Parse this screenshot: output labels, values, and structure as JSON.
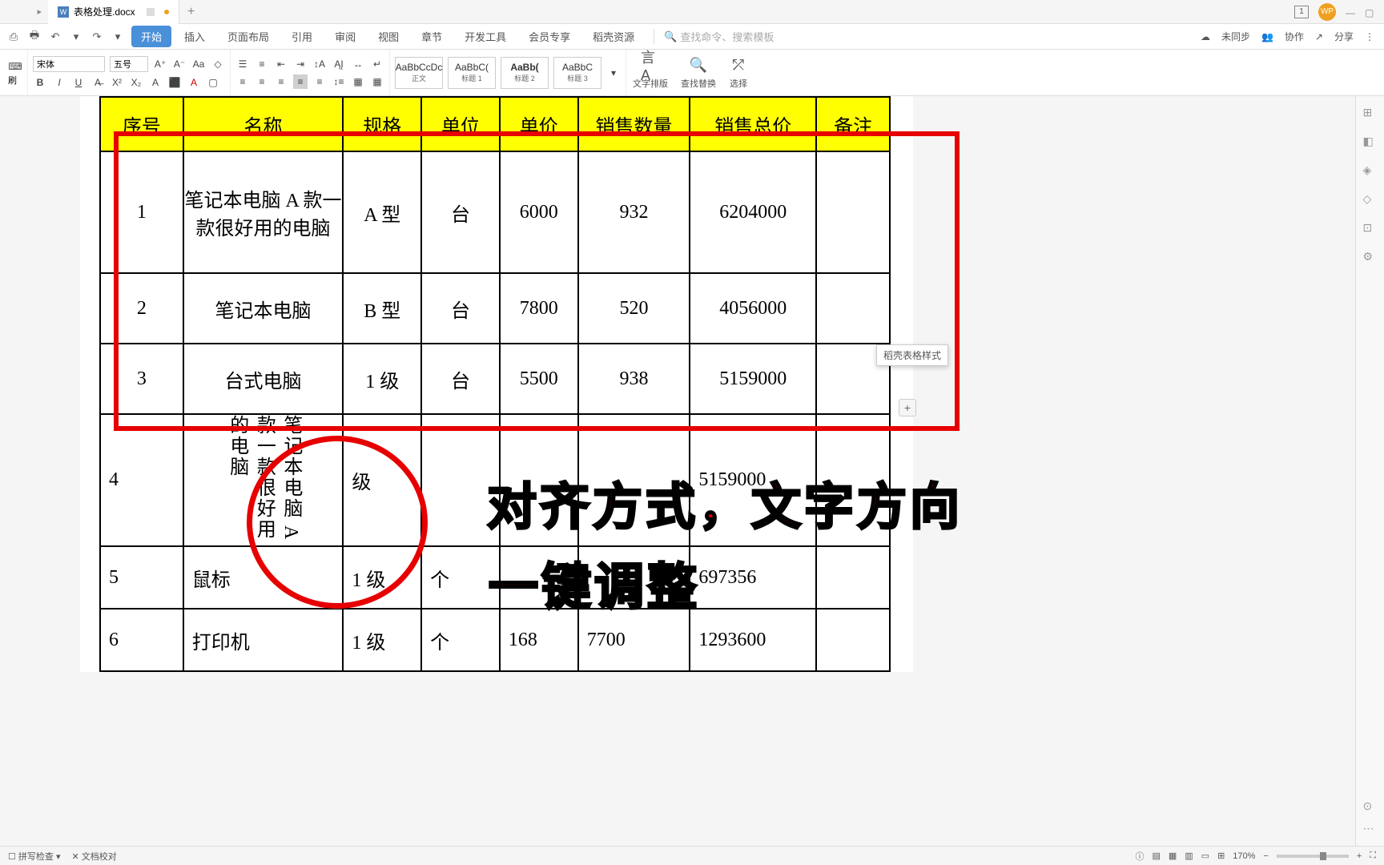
{
  "tab": {
    "filename": "表格处理.docx",
    "doc_badge": "W"
  },
  "tab_right": {
    "num": "1",
    "avatar": "WP"
  },
  "menu": {
    "tabs": [
      "开始",
      "插入",
      "页面布局",
      "引用",
      "审阅",
      "视图",
      "章节",
      "开发工具",
      "会员专享",
      "稻壳资源"
    ],
    "active": "开始",
    "search_placeholder": "查找命令、搜索模板",
    "right": {
      "sync": "未同步",
      "collab": "协作",
      "share": "分享"
    }
  },
  "ribbon": {
    "brush": "刷",
    "font": "宋体",
    "size": "五号",
    "styles": [
      {
        "sample": "AaBbCcDc",
        "name": "正文"
      },
      {
        "sample": "AaBbC(",
        "name": "标题 1"
      },
      {
        "sample": "AaBb(",
        "name": "标题 2"
      },
      {
        "sample": "AaBbC",
        "name": "标题 3"
      }
    ],
    "text_layout": "文字排版",
    "find_replace": "查找替换",
    "select": "选择"
  },
  "tooltip": "稻壳表格样式",
  "table": {
    "headers": [
      "序号",
      "名称",
      "规格",
      "单位",
      "单价",
      "销售数量",
      "销售总价",
      "备注"
    ],
    "rows": [
      {
        "n": "1",
        "name": "笔记本电脑 A 款一款很好用的电脑",
        "spec": "A 型",
        "unit": "台",
        "price": "6000",
        "qty": "932",
        "total": "6204000",
        "note": ""
      },
      {
        "n": "2",
        "name": "笔记本电脑",
        "spec": "B 型",
        "unit": "台",
        "price": "7800",
        "qty": "520",
        "total": "4056000",
        "note": ""
      },
      {
        "n": "3",
        "name": "台式电脑",
        "spec": "1 级",
        "unit": "台",
        "price": "5500",
        "qty": "938",
        "total": "5159000",
        "note": ""
      },
      {
        "n": "4",
        "name": "笔记本电脑 A 款一款很好用的电脑",
        "spec": "级",
        "unit": "",
        "price": "",
        "qty": "",
        "total": "5159000",
        "note": ""
      },
      {
        "n": "5",
        "name": "鼠标",
        "spec": "1 级",
        "unit": "个",
        "price": "",
        "qty": "",
        "total": "697356",
        "note": ""
      },
      {
        "n": "6",
        "name": "打印机",
        "spec": "1 级",
        "unit": "个",
        "price": "168",
        "qty": "7700",
        "total": "1293600",
        "note": ""
      }
    ]
  },
  "overlay": {
    "line1": "对齐方式，文字方向",
    "line2": "一键调整"
  },
  "status": {
    "spellcheck": "拼写检查",
    "doccheck": "文档校对",
    "zoom": "170%"
  }
}
